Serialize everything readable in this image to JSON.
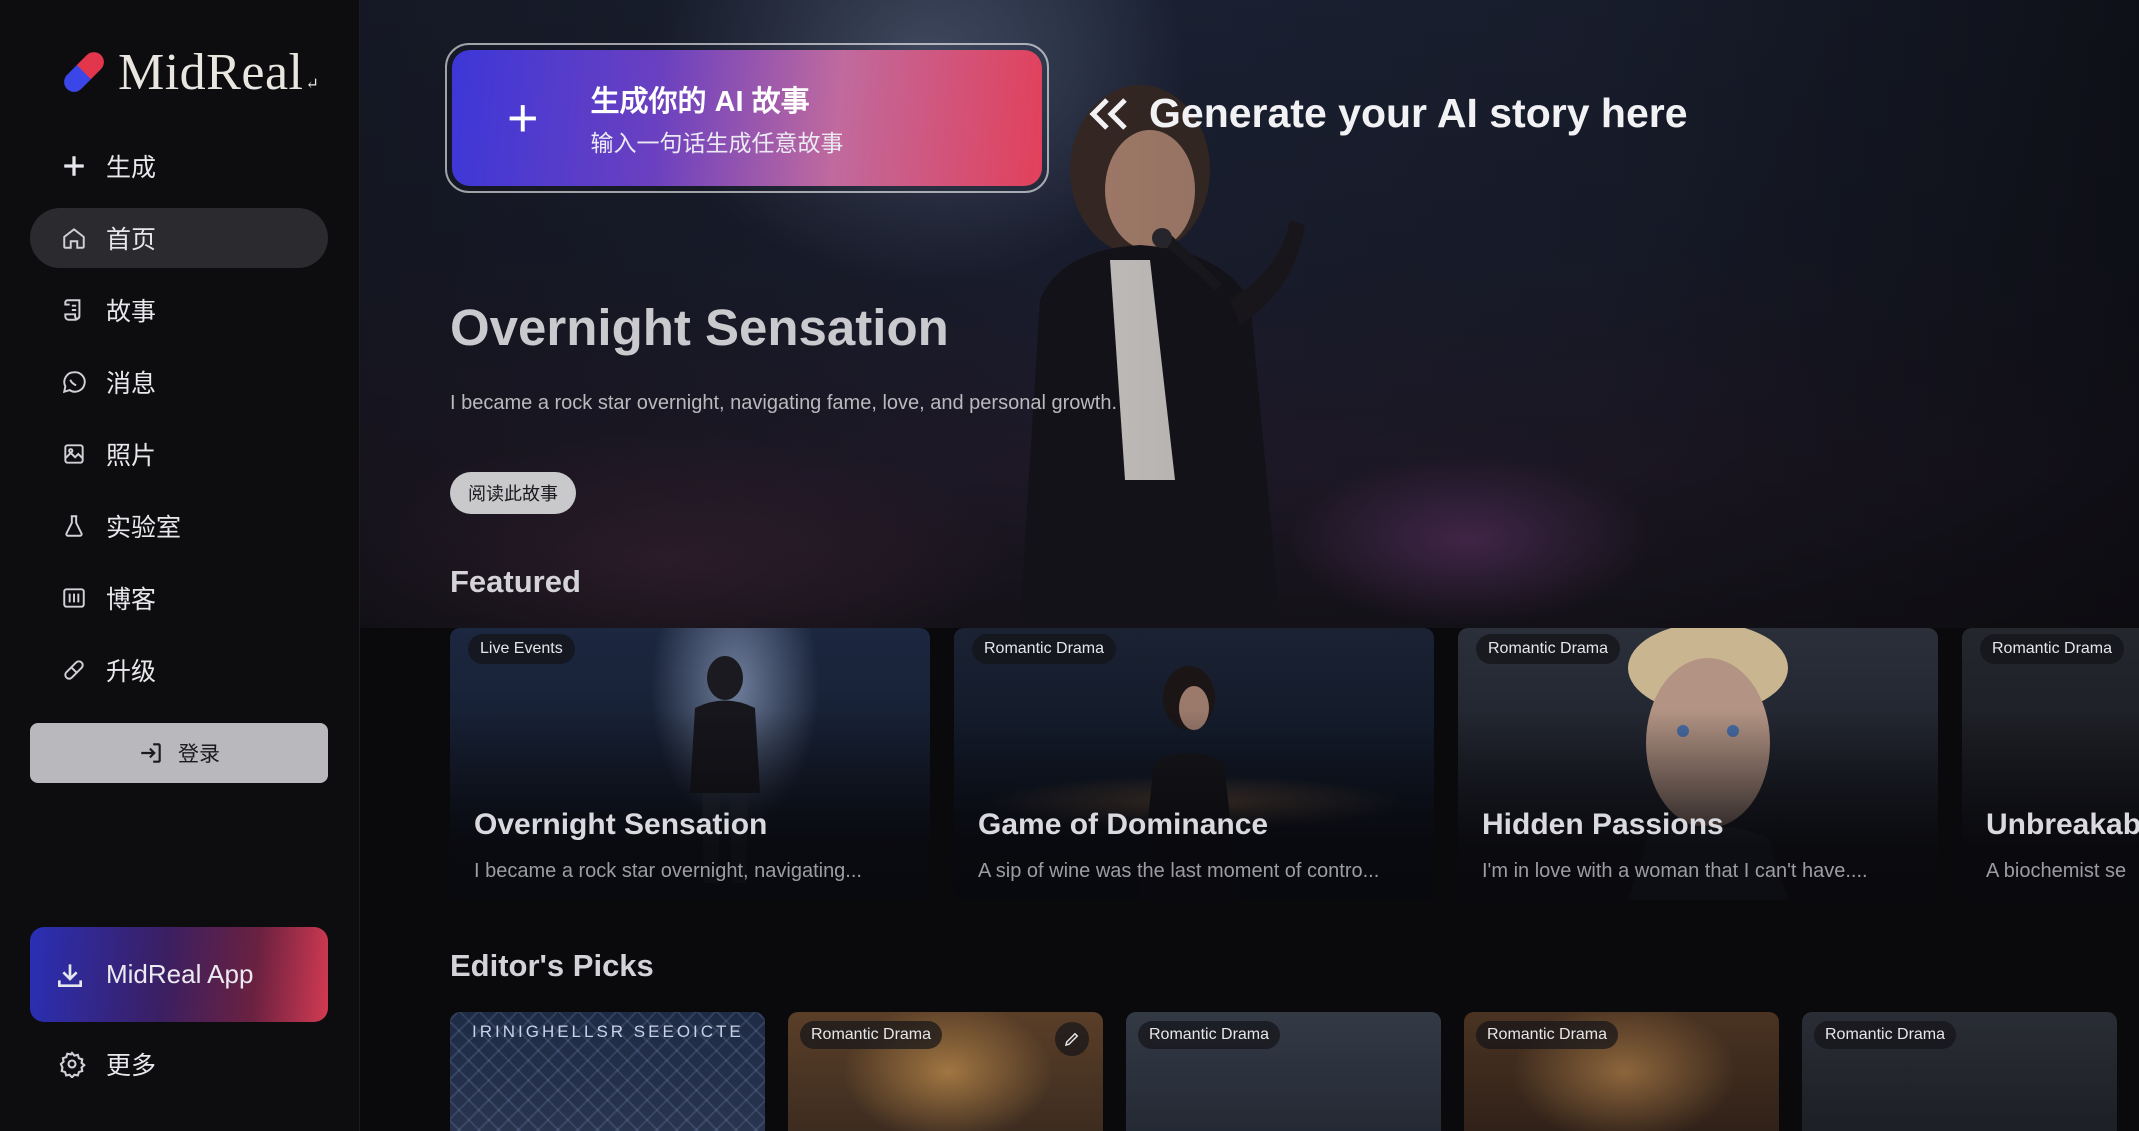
{
  "brand": {
    "name": "MidReal",
    "suffix": "↵"
  },
  "sidebar": {
    "items": [
      {
        "label": "生成",
        "icon": "plus-icon"
      },
      {
        "label": "首页",
        "icon": "home-icon"
      },
      {
        "label": "故事",
        "icon": "scroll-icon"
      },
      {
        "label": "消息",
        "icon": "chat-icon"
      },
      {
        "label": "照片",
        "icon": "photo-icon"
      },
      {
        "label": "实验室",
        "icon": "flask-icon"
      },
      {
        "label": "博客",
        "icon": "blog-icon"
      },
      {
        "label": "升级",
        "icon": "pill-icon"
      }
    ],
    "active_index": 1,
    "login_label": "登录",
    "app_label": "MidReal App",
    "more_label": "更多"
  },
  "generate": {
    "title": "生成你的 AI 故事",
    "subtitle": "输入一句话生成任意故事",
    "hint": "Generate your AI story here"
  },
  "hero": {
    "title": "Overnight Sensation",
    "description": "I became a rock star overnight, navigating fame, love, and personal growth.",
    "read_label": "阅读此故事"
  },
  "featured": {
    "heading": "Featured",
    "cards": [
      {
        "tag": "Live Events",
        "title": "Overnight Sensation",
        "desc": "I became a rock star overnight, navigating..."
      },
      {
        "tag": "Romantic Drama",
        "title": "Game of Dominance",
        "desc": "A sip of wine was the last moment of contro..."
      },
      {
        "tag": "Romantic Drama",
        "title": "Hidden Passions",
        "desc": "I'm in love with a woman that I can't have...."
      },
      {
        "tag": "Romantic Drama",
        "title": "Unbreakable",
        "desc": "A biochemist se"
      }
    ]
  },
  "picks": {
    "heading": "Editor's Picks",
    "cards": [
      {
        "tag": "",
        "text": "IRINIGHELLSR SEEOICTE"
      },
      {
        "tag": "Romantic Drama",
        "text": ""
      },
      {
        "tag": "Romantic Drama",
        "text": ""
      },
      {
        "tag": "Romantic Drama",
        "text": ""
      },
      {
        "tag": "Romantic Drama",
        "text": ""
      }
    ]
  },
  "colors": {
    "accent_blue": "#3a46e8",
    "accent_red": "#e2364d",
    "sidebar_bg": "#0d0d10",
    "active_item_bg": "#2a2a2f"
  }
}
